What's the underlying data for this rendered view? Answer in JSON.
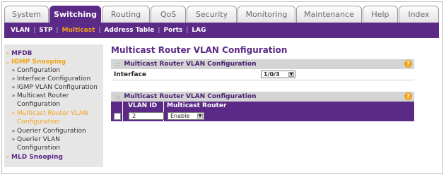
{
  "tabs": [
    {
      "label": "System"
    },
    {
      "label": "Switching",
      "active": true
    },
    {
      "label": "Routing"
    },
    {
      "label": "QoS"
    },
    {
      "label": "Security"
    },
    {
      "label": "Monitoring"
    },
    {
      "label": "Maintenance"
    },
    {
      "label": "Help"
    },
    {
      "label": "Index"
    }
  ],
  "subnav": [
    {
      "label": "VLAN"
    },
    {
      "label": "STP"
    },
    {
      "label": "Multicast",
      "active": true
    },
    {
      "label": "Address Table"
    },
    {
      "label": "Ports"
    },
    {
      "label": "LAG"
    }
  ],
  "sidebar": {
    "mfdb": "MFDB",
    "igmp": "IGMP Snooping",
    "configuration": "Configuration",
    "interface_configuration": "Interface Configuration",
    "igmp_vlan_configuration": "IGMP VLAN Configuration",
    "multicast_router_1": "Multicast Router",
    "multicast_router_2": "Configuration",
    "multicast_router_vlan_1": "Multicast Router VLAN",
    "multicast_router_vlan_2": "Configuration",
    "querier_configuration": "Querier Configuration",
    "querier_vlan_1": "Querier VLAN",
    "querier_vlan_2": "Configuration",
    "mld": "MLD Snooping"
  },
  "page": {
    "title": "Multicast Router VLAN Configuration",
    "section1_title": "Multicast Router VLAN Configuration",
    "interface_label": "Interface",
    "interface_value": "1/0/3",
    "section2_title": "Multicast Router VLAN Configuration",
    "col_vlan_id": "VLAN ID",
    "col_multicast_router": "Multicast Router",
    "vlan_id_value": "2",
    "multicast_router_value": "Enable"
  },
  "icons": {
    "help": "?",
    "caret": "▼",
    "arrow": "›"
  },
  "colors": {
    "brand_purple": "#5b2a86",
    "accent_orange": "#f2a31c"
  }
}
